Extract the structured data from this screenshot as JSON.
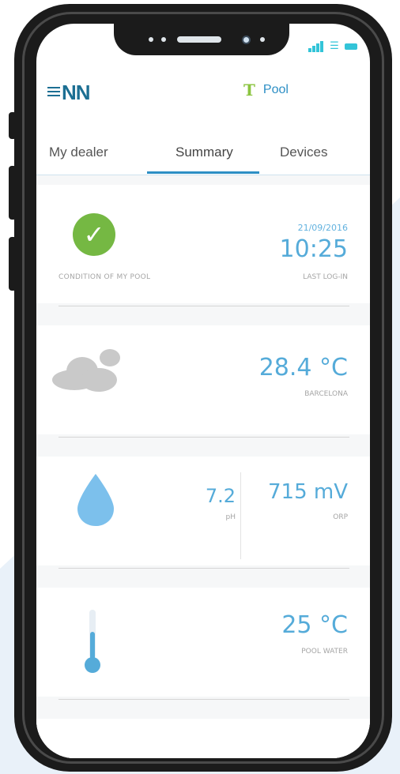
{
  "app": {
    "logo": "≡NN",
    "pool_icon": "T",
    "pool_label": "Pool"
  },
  "tabs": [
    {
      "label": "My dealer"
    },
    {
      "label": "Summary",
      "active": true
    },
    {
      "label": "Devices"
    }
  ],
  "condition": {
    "label": "CONDITION OF MY POOL",
    "date": "21/09/2016",
    "time": "10:25",
    "time_label": "LAST LOG-IN",
    "status_icon": "check-circle-icon"
  },
  "weather": {
    "icon": "cloud-icon",
    "temperature": "28.4 °C",
    "location": "BARCELONA"
  },
  "chemistry": {
    "icon": "water-drop-icon",
    "ph_value": "7.2",
    "ph_label": "pH",
    "orp_value": "715 mV",
    "orp_label": "ORP"
  },
  "water": {
    "icon": "thermometer-icon",
    "temperature": "25 °C",
    "label": "POOL WATER"
  },
  "colors": {
    "accent": "#2d8fc5",
    "value_blue": "#55abd9",
    "ok_green": "#75b843",
    "signal": "#33c4d8"
  }
}
